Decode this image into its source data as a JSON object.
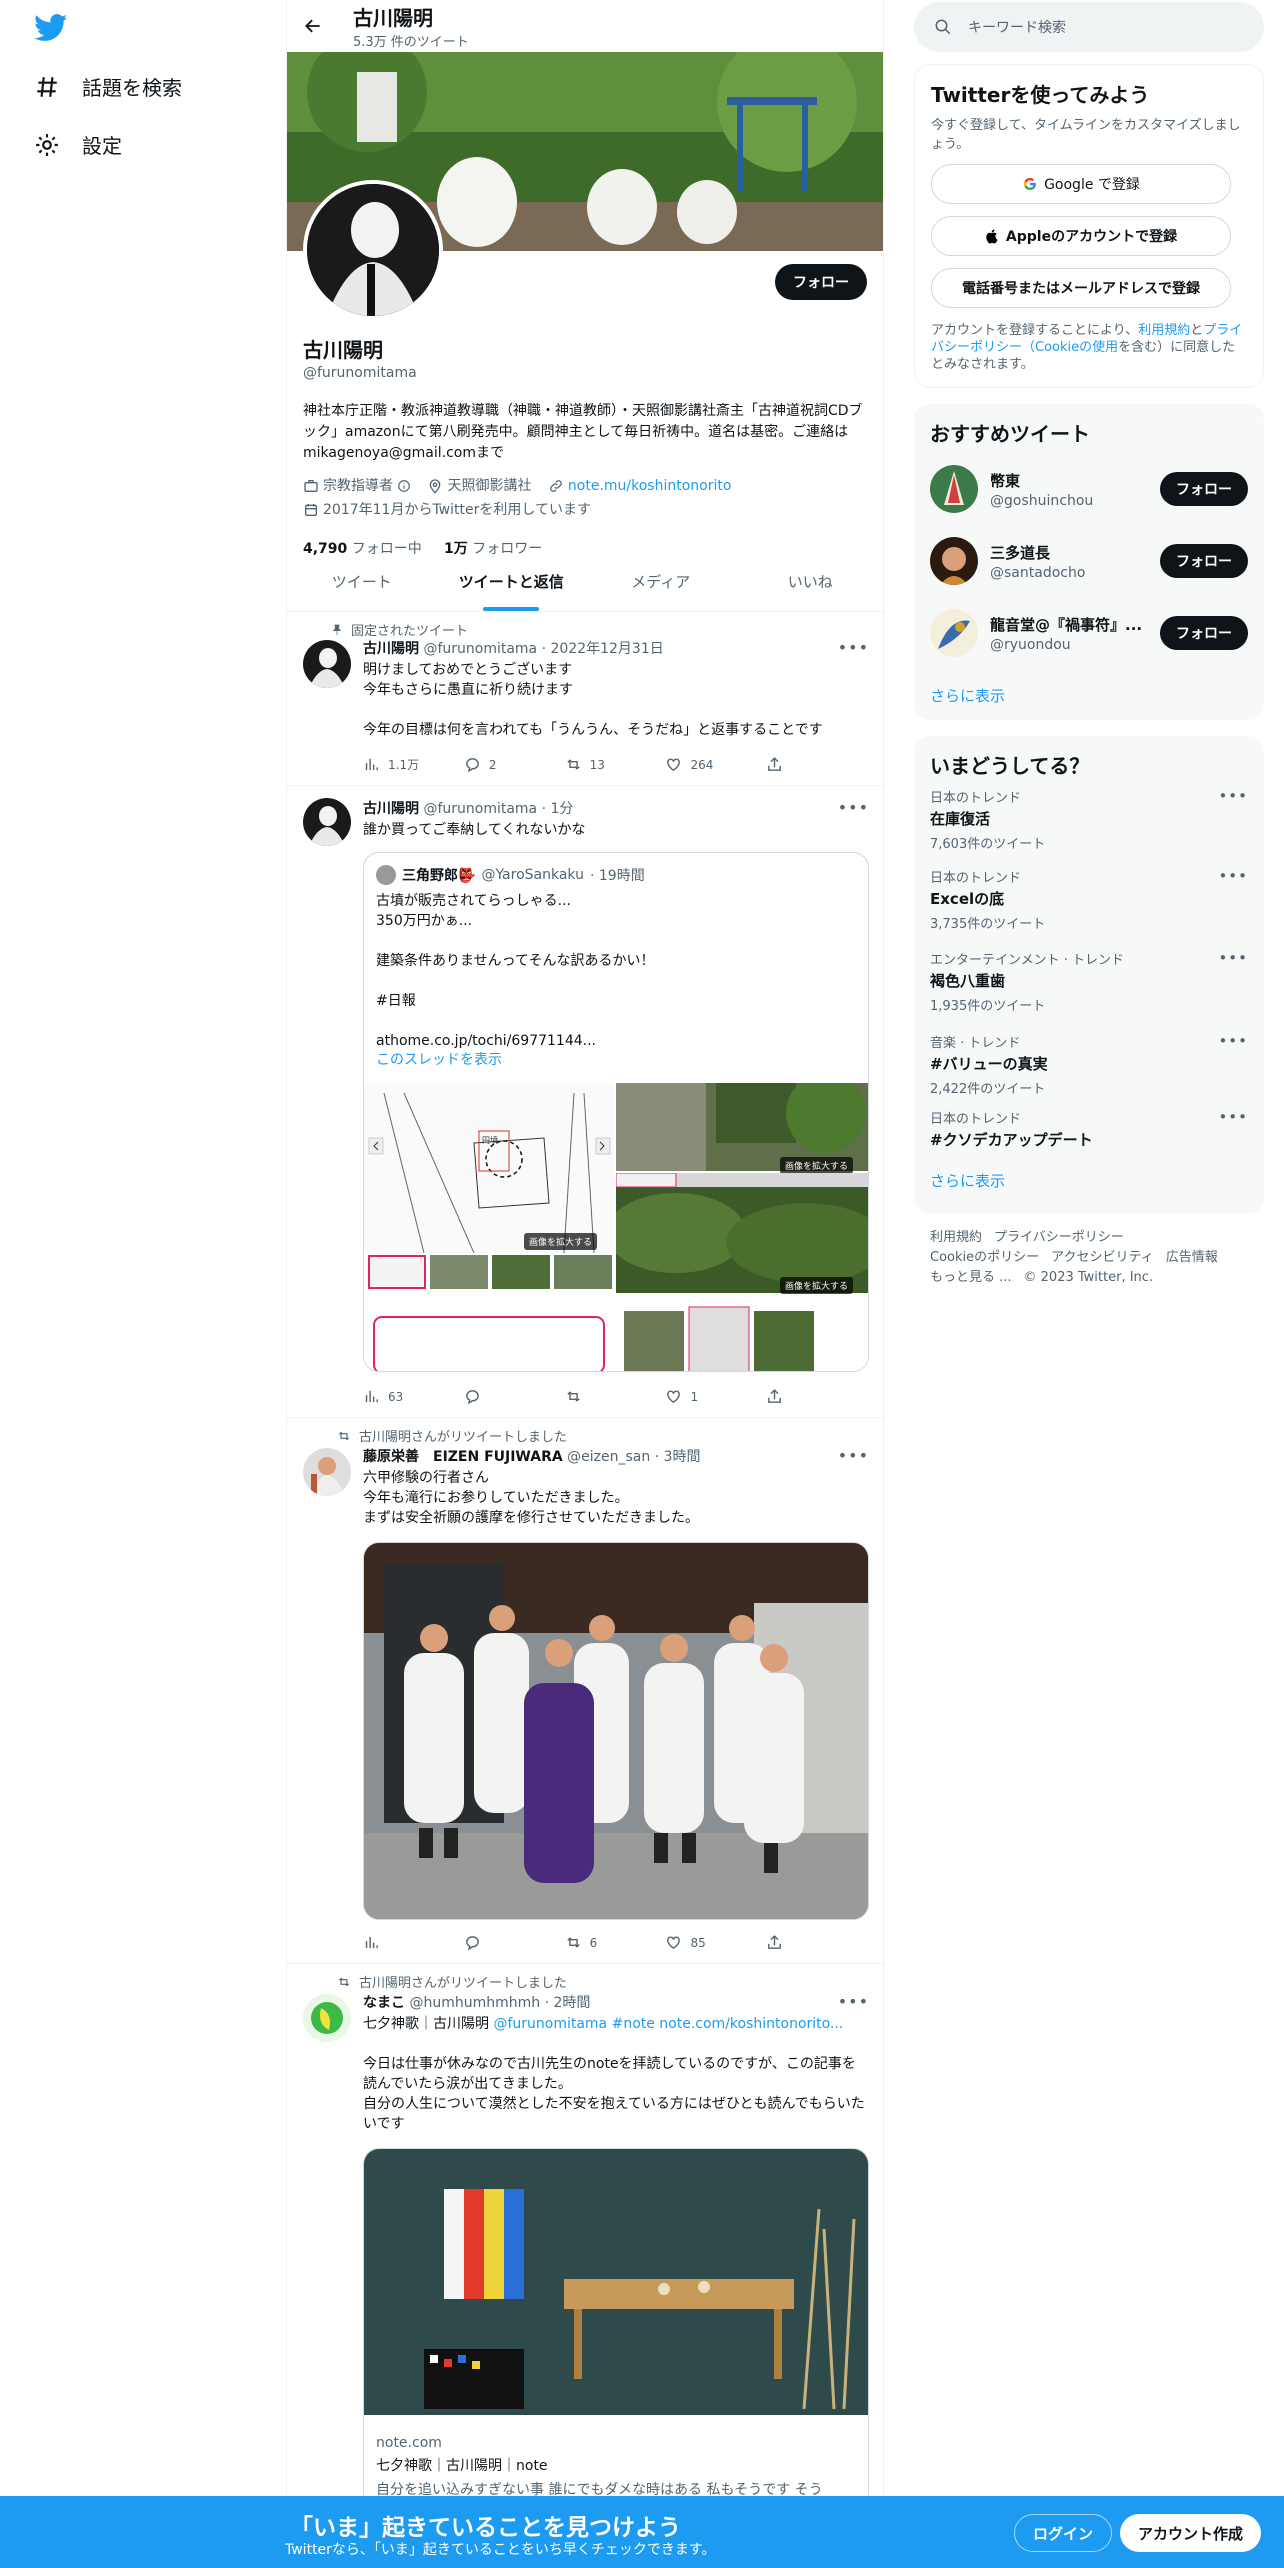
{
  "left_nav": {
    "items": [
      {
        "label": "話題を検索",
        "icon": "hash-icon"
      },
      {
        "label": "設定",
        "icon": "gear-icon"
      }
    ]
  },
  "header": {
    "name": "古川陽明",
    "tweet_count": "5.3万 件のツイート"
  },
  "profile": {
    "follow_label": "フォロー",
    "name": "古川陽明",
    "handle": "@furunomitama",
    "bio": "神社本庁正階・教派神道教導職（神職・神道教師）・天照御影講社斎主「古神道祝詞CDブック」amazonにて第八刷発売中。顧問神主として毎日祈祷中。道名は基密。ご連絡はmikagenoya@gmail.comまで",
    "category": "宗教指導者",
    "location": "天照御影講社",
    "link": "note.mu/koshintonorito",
    "joined": "2017年11月からTwitterを利用しています",
    "following_count": "4,790",
    "following_label": "フォロー中",
    "followers_count": "1万",
    "followers_label": "フォロワー"
  },
  "tabs": [
    "ツイート",
    "ツイートと返信",
    "メディア",
    "いいね"
  ],
  "tweets": [
    {
      "context": "固定されたツイート",
      "name": "古川陽明",
      "handle": "@furunomitama",
      "time": "· 2022年12月31日",
      "text": "明けましておめでとうございます\n今年もさらに愚直に祈り続けます\n\n今年の目標は何を言われても「うんうん、そうだね」と返事することです",
      "views": "1.1万",
      "replies": "2",
      "retweets": "13",
      "likes": "264"
    },
    {
      "name": "古川陽明",
      "handle": "@furunomitama",
      "time": "· 1分",
      "text": "誰か買ってご奉納してくれないかな",
      "quote": {
        "name": "三角野郎👺",
        "handle": "@YaroSankaku",
        "time": "· 19時間",
        "text": "古墳が販売されてらっしゃる...\n350万円かぁ...\n\n建築条件ありませんってそんな訳あるかい！\n\n#日報\n\nathome.co.jp/tochi/69771144...",
        "thread_link": "このスレッドを表示",
        "zoom_label": "画像を拡大する",
        "map_label": "円墳"
      },
      "views": "63",
      "replies": "",
      "retweets": "",
      "likes": "1"
    },
    {
      "context": "古川陽明さんがリツイートしました",
      "name": "藤原栄善　EIZEN FUJIWARA",
      "handle": "@eizen_san",
      "time": "· 3時間",
      "text": "六甲修験の行者さん\n今年も滝行にお参りしていただきました。\nまずは安全祈願の護摩を修行させていただきました。",
      "views": "",
      "replies": "",
      "retweets": "6",
      "likes": "85"
    },
    {
      "context": "古川陽明さんがリツイートしました",
      "name": "なまこ",
      "handle": "@humhumhmhmh",
      "time": "· 2時間",
      "text_prefix": "七夕神歌｜古川陽明 ",
      "text_links": "@furunomitama #note note.com/koshintonorito...",
      "text": "今日は仕事が休みなので古川先生のnoteを拝読しているのですが、この記事を読んでいたら涙が出てきました。\n自分の人生について漠然とした不安を抱えている方にはぜひとも読んでもらいたいです",
      "card": {
        "domain": "note.com",
        "title": "七夕神歌｜古川陽明｜note",
        "desc": "自分を追い込みすぎない事 誰にでもダメな時はある 私もそうです そう"
      }
    }
  ],
  "right": {
    "search_placeholder": "キーワード検索",
    "join": {
      "title": "Twitterを使ってみよう",
      "subtitle": "今すぐ登録して、タイムラインをカスタマイズしましょう。",
      "google": "Google で登録",
      "apple": "Appleのアカウントで登録",
      "phone": "電話番号またはメールアドレスで登録",
      "terms_pre": "アカウントを登録することにより、",
      "terms_link1": "利用規約",
      "terms_mid": "と",
      "terms_link2": "プライバシーポリシー（Cookieの使用",
      "terms_post": "を含む）に同意したとみなされます。"
    },
    "recommend": {
      "title": "おすすめツイート",
      "users": [
        {
          "name": "幣東",
          "handle": "@goshuinchou"
        },
        {
          "name": "三多道長",
          "handle": "@santadocho"
        },
        {
          "name": "龍音堂@『禍事符』...",
          "handle": "@ryuondou"
        }
      ],
      "follow_label": "フォロー",
      "more": "さらに表示"
    },
    "trends": {
      "title": "いまどうしてる？",
      "items": [
        {
          "category": "日本のトレンド",
          "topic": "在庫復活",
          "count": "7,603件のツイート"
        },
        {
          "category": "日本のトレンド",
          "topic": "Excelの底",
          "count": "3,735件のツイート"
        },
        {
          "category": "エンターテインメント · トレンド",
          "topic": "褐色八重歯",
          "count": "1,935件のツイート"
        },
        {
          "category": "音楽 · トレンド",
          "topic": "#バリューの真実",
          "count": "2,422件のツイート"
        },
        {
          "category": "日本のトレンド",
          "topic": "#クソデカアップデート",
          "count": ""
        }
      ],
      "more": "さらに表示"
    },
    "footer": {
      "line1": [
        "利用規約",
        "プライバシーポリシー"
      ],
      "line2": [
        "Cookieのポリシー",
        "アクセシビリティ",
        "広告情報"
      ],
      "line3": [
        "もっと見る ...",
        "© 2023 Twitter, Inc."
      ]
    }
  },
  "bottom_bar": {
    "title": "「いま」起きていることを見つけよう",
    "subtitle": "Twitterなら、「いま」起きていることをいち早くチェックできます。",
    "login": "ログイン",
    "signup": "アカウント作成"
  },
  "colors": {
    "accent": "#1d9bf0",
    "text": "#0f1419",
    "muted": "#536471"
  }
}
